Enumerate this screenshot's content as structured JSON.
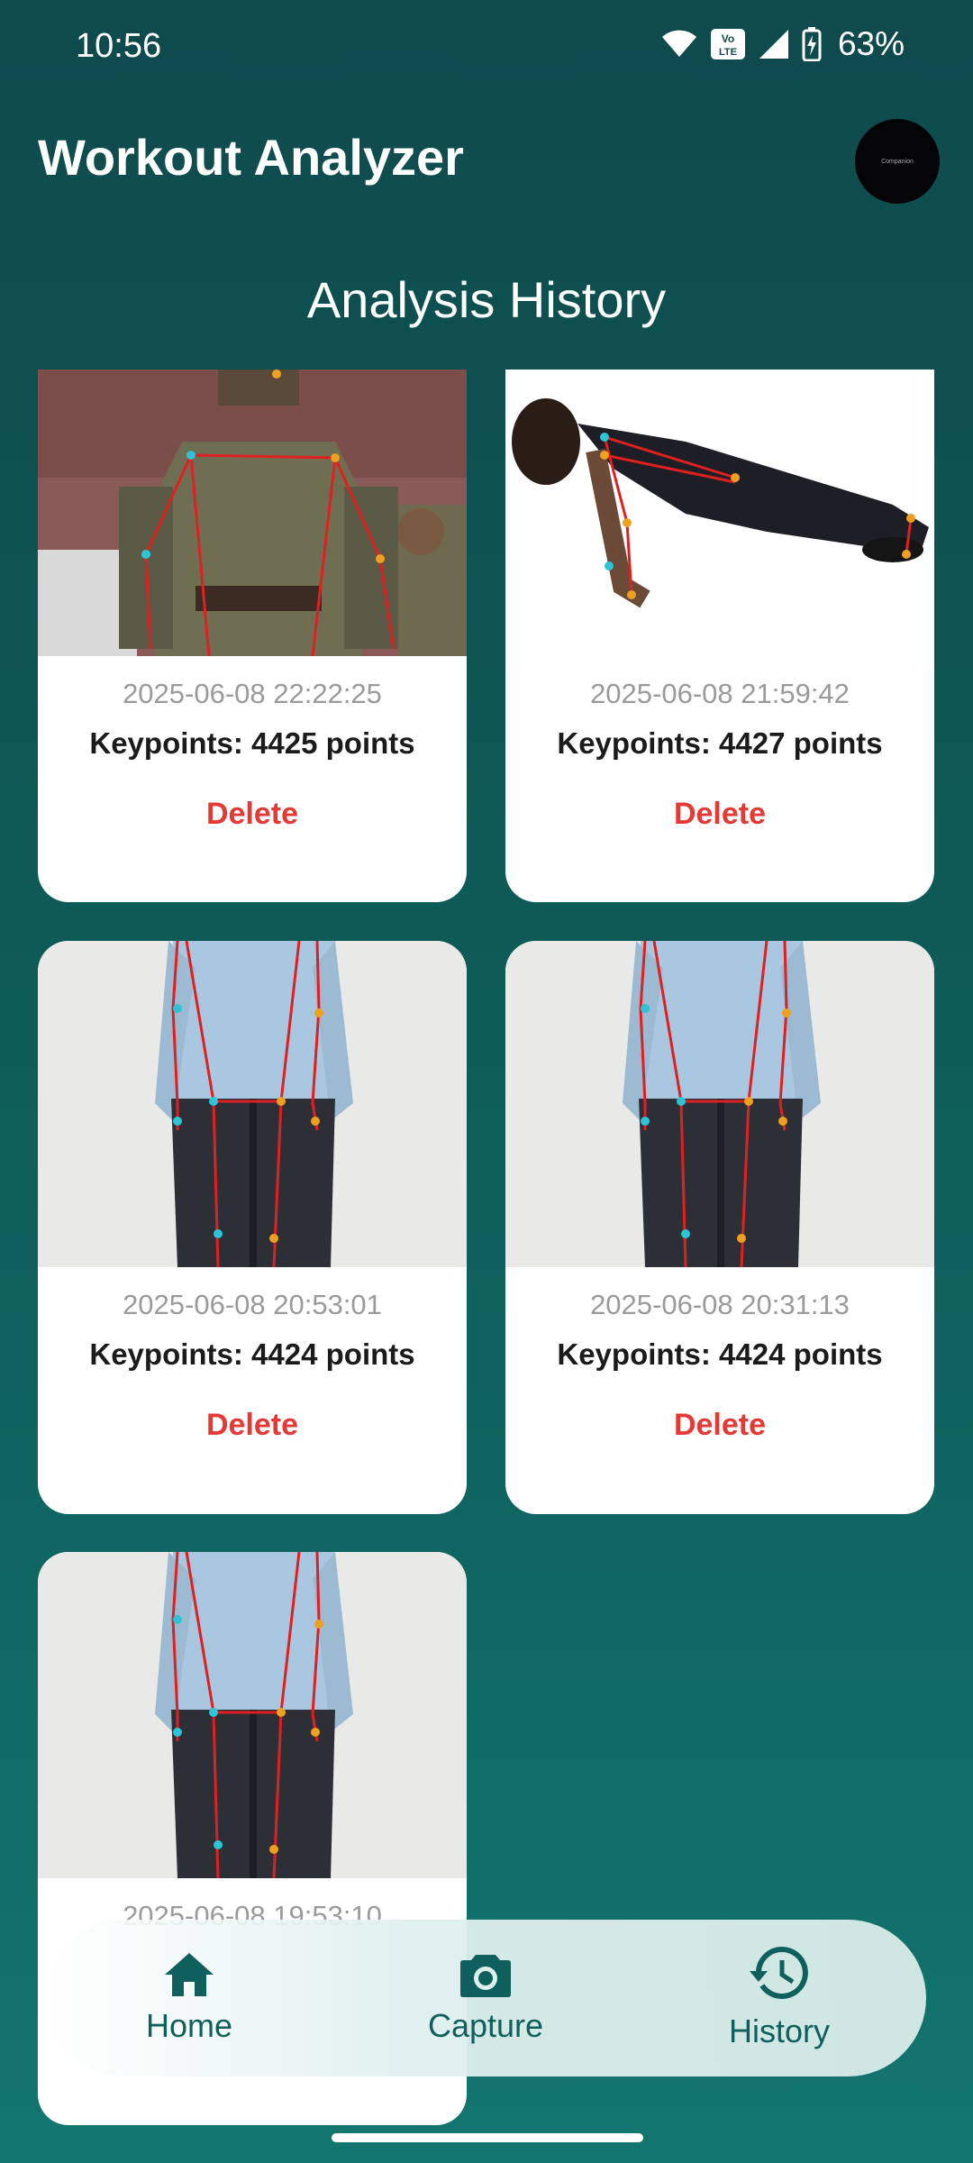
{
  "status_bar": {
    "time": "10:56",
    "battery": "63%",
    "icons": [
      "wifi-icon",
      "volte-icon",
      "signal-icon",
      "battery-charging-icon"
    ]
  },
  "header": {
    "title": "Workout Analyzer",
    "avatar_text": "Companion"
  },
  "section_title": "Analysis History",
  "records": [
    {
      "timestamp": "2025-06-08 22:22:25",
      "keypoints": "Keypoints: 4425 points",
      "delete_label": "Delete"
    },
    {
      "timestamp": "2025-06-08 21:59:42",
      "keypoints": "Keypoints: 4427 points",
      "delete_label": "Delete"
    },
    {
      "timestamp": "2025-06-08 20:53:01",
      "keypoints": "Keypoints: 4424 points",
      "delete_label": "Delete"
    },
    {
      "timestamp": "2025-06-08 20:31:13",
      "keypoints": "Keypoints: 4424 points",
      "delete_label": "Delete"
    },
    {
      "timestamp": "2025-06-08 19:53:10",
      "keypoints": "",
      "delete_label": ""
    }
  ],
  "bottom_nav": {
    "items": [
      {
        "label": "Home",
        "icon": "home-icon"
      },
      {
        "label": "Capture",
        "icon": "camera-icon"
      },
      {
        "label": "History",
        "icon": "history-icon",
        "selected": true
      }
    ]
  },
  "colors": {
    "background_top": "#0f4a4d",
    "background_bottom": "#12766f",
    "delete": "#e53935",
    "nav_accent": "#0f5f5c"
  }
}
